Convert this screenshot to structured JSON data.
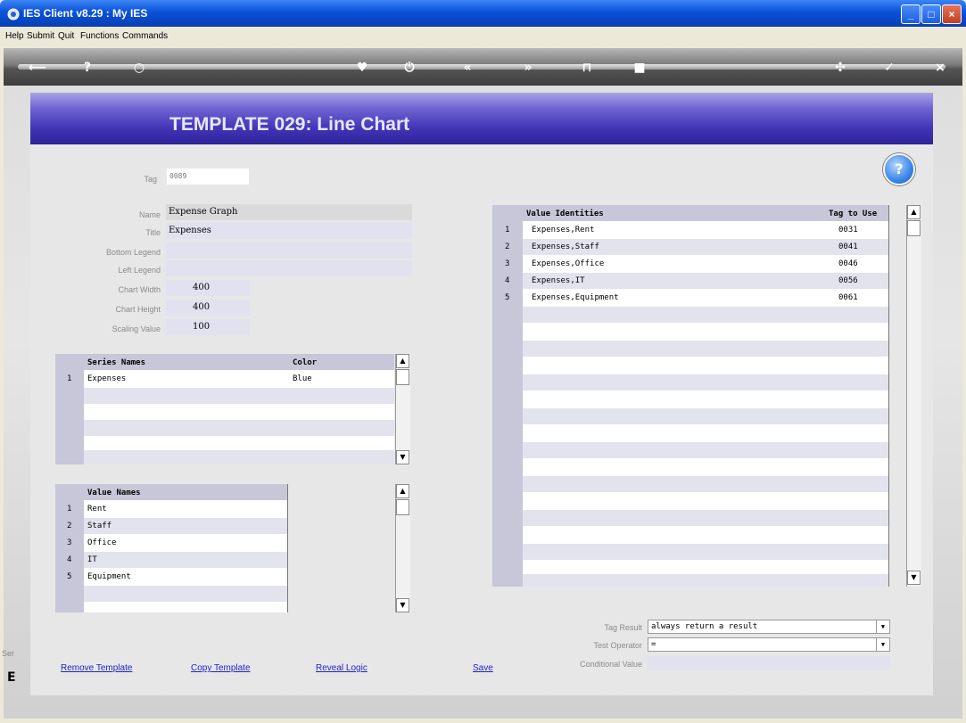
{
  "window": {
    "title": "IES Client v8.29 : My IES"
  },
  "menu": [
    "Help",
    "Submit",
    "Quit",
    "Functions",
    "Commands"
  ],
  "toolbar_icons": [
    "back-icon",
    "help-icon",
    "search-icon",
    "heart-icon",
    "power-icon",
    "rewind-icon",
    "forward-icon",
    "split-icon",
    "stop-icon",
    "settings-icon",
    "check-icon",
    "close-icon"
  ],
  "page": {
    "title": "TEMPLATE 029: Line Chart"
  },
  "form": {
    "tag_label": "Tag",
    "tag_value": "0089",
    "name_label": "Name",
    "name_value": "Expense Graph",
    "title_label": "Title",
    "title_value": "Expenses",
    "bottom_legend_label": "Bottom Legend",
    "bottom_legend_value": "",
    "left_legend_label": "Left Legend",
    "left_legend_value": "",
    "chart_width_label": "Chart Width",
    "chart_width_value": "400",
    "chart_height_label": "Chart Height",
    "chart_height_value": "400",
    "scaling_label": "Scaling Value",
    "scaling_value": "100"
  },
  "series": {
    "headers": [
      "Series Names",
      "Color"
    ],
    "rows": [
      {
        "num": "1",
        "name": "Expenses",
        "color": "Blue"
      }
    ]
  },
  "value_names": {
    "header": "Value Names",
    "rows": [
      {
        "num": "1",
        "name": "Rent"
      },
      {
        "num": "2",
        "name": "Staff"
      },
      {
        "num": "3",
        "name": "Office"
      },
      {
        "num": "4",
        "name": "IT"
      },
      {
        "num": "5",
        "name": "Equipment"
      }
    ]
  },
  "value_identities": {
    "headers": [
      "Value Identities",
      "Tag to Use"
    ],
    "rows": [
      {
        "num": "1",
        "identity": "Expenses,Rent",
        "tag": "0031"
      },
      {
        "num": "2",
        "identity": "Expenses,Staff",
        "tag": "0041"
      },
      {
        "num": "3",
        "identity": "Expenses,Office",
        "tag": "0046"
      },
      {
        "num": "4",
        "identity": "Expenses,IT",
        "tag": "0056"
      },
      {
        "num": "5",
        "identity": "Expenses,Equipment",
        "tag": "0061"
      }
    ]
  },
  "bottom": {
    "tag_result_label": "Tag Result",
    "tag_result_value": "always return a result",
    "test_operator_label": "Test Operator",
    "test_operator_value": "=",
    "conditional_label": "Conditional Value",
    "conditional_value": ""
  },
  "links": {
    "remove": "Remove Template",
    "copy": "Copy Template",
    "reveal": "Reveal Logic",
    "save": "Save"
  },
  "edge_text": "Ser"
}
